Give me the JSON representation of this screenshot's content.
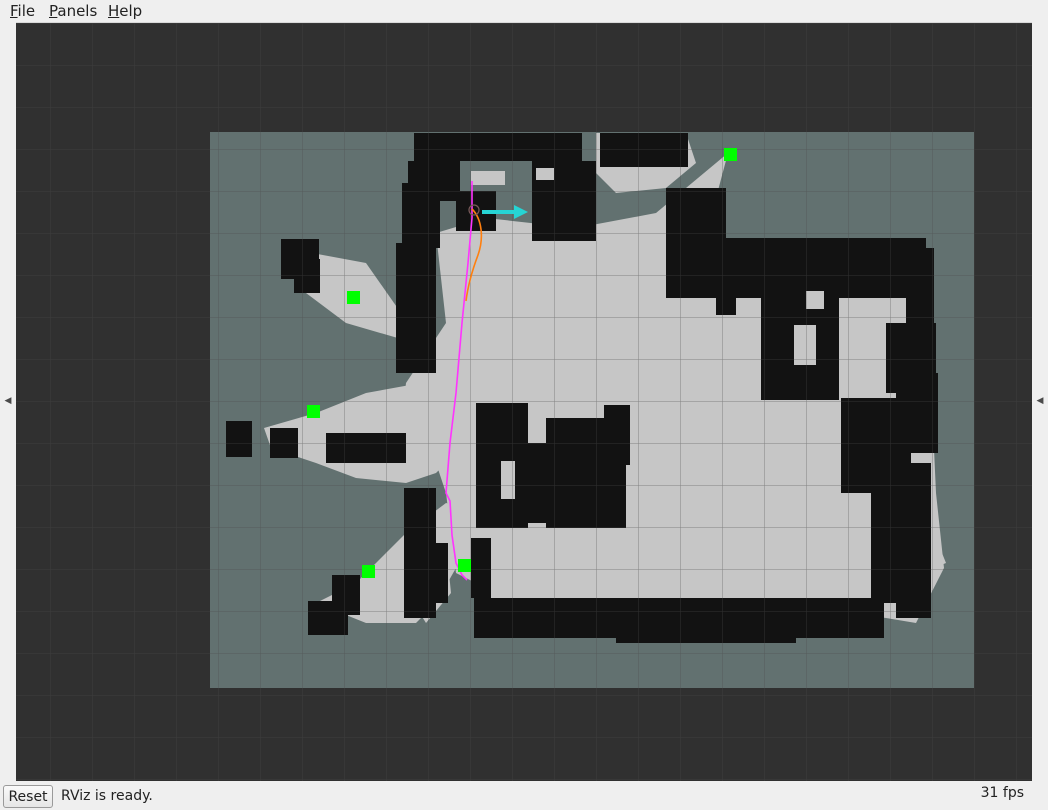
{
  "menu": {
    "file": "File",
    "panels": "Panels",
    "help": "Help"
  },
  "statusbar": {
    "reset_label": "Reset",
    "status": "RViz is ready.",
    "fps": "31 fps"
  },
  "colors": {
    "background": "#303030",
    "grid": "#4a4a4a",
    "unknown": "#627170",
    "free": "#c6c6c6",
    "occupied": "#121212",
    "goal_marker": "#00ff00",
    "planned_path": "#ff33ff",
    "robot_path": "#ff7f0e",
    "pose_arrow": "#26d4d4"
  },
  "icons": {
    "left_panel_toggle": "triangle-left-icon",
    "right_panel_toggle": "triangle-left-icon"
  }
}
